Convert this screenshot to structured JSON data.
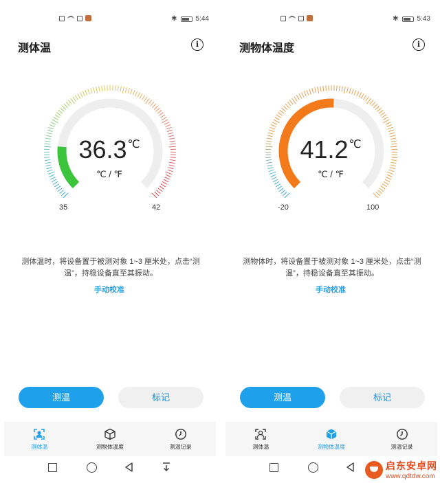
{
  "screens": [
    {
      "status": {
        "time": "5:44"
      },
      "title": "测体温",
      "reading": {
        "value": "36.3",
        "unit": "℃",
        "min_label": "35",
        "max_label": "42",
        "min": 35,
        "max": 42,
        "fill_color": "#3dc43d"
      },
      "unit_toggle": "℃ / ℉",
      "instruction": "测体温时，将设备置于被测对象 1~3 厘米处，点击“测温”，持稳设备直至其振动。",
      "manual_link": "手动校准",
      "buttons": {
        "measure": "测温",
        "mark": "标记"
      },
      "nav": [
        {
          "label": "测体温",
          "icon": "person-icon",
          "active": true
        },
        {
          "label": "测物体温度",
          "icon": "cube-icon",
          "active": false
        },
        {
          "label": "测温记录",
          "icon": "clock-icon",
          "active": false
        }
      ]
    },
    {
      "status": {
        "time": "5:43"
      },
      "title": "测物体温度",
      "reading": {
        "value": "41.2",
        "unit": "℃",
        "min_label": "-20",
        "max_label": "100",
        "min": -20,
        "max": 100,
        "fill_color": "#f27a1a"
      },
      "unit_toggle": "℃ / ℉",
      "instruction": "测物体时，将设备置于被测对象 1~3 厘米处，点击“测温”，持稳设备直至其振动。",
      "manual_link": "手动校准",
      "buttons": {
        "measure": "测温",
        "mark": "标记"
      },
      "nav": [
        {
          "label": "测体温",
          "icon": "person-icon",
          "active": false
        },
        {
          "label": "测物体温度",
          "icon": "cube-icon",
          "active": true
        },
        {
          "label": "测温记录",
          "icon": "clock-icon",
          "active": false
        }
      ]
    }
  ],
  "watermark": {
    "name": "启东安卓网",
    "url": "www.qdtdw.com"
  }
}
